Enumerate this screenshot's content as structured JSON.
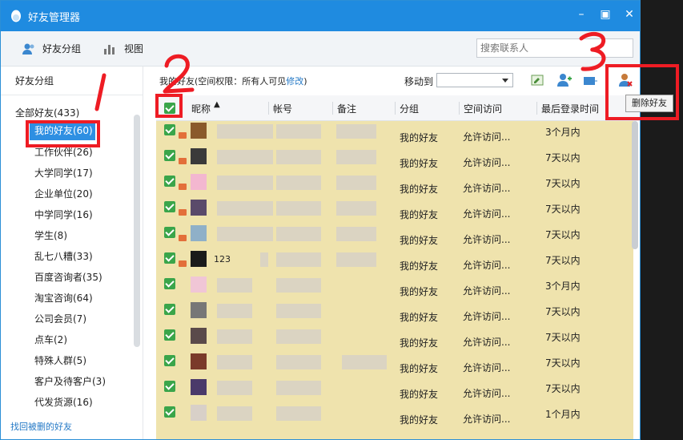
{
  "window": {
    "title": "好友管理器"
  },
  "toolbar": {
    "friend_groups": "好友分组",
    "view": "视图",
    "search_placeholder": "搜索联系人"
  },
  "sidebar": {
    "heading": "好友分组",
    "all": "全部好友(433)",
    "groups": [
      {
        "label": "我的好友(60)",
        "selected": true
      },
      {
        "label": "工作伙伴(26)"
      },
      {
        "label": "大学同学(17)"
      },
      {
        "label": "企业单位(20)"
      },
      {
        "label": "中学同学(16)"
      },
      {
        "label": "学生(8)"
      },
      {
        "label": "乱七八糟(33)"
      },
      {
        "label": "百度咨询者(35)"
      },
      {
        "label": "淘宝咨询(64)"
      },
      {
        "label": "公司会员(7)"
      },
      {
        "label": "点车(2)"
      },
      {
        "label": "特殊人群(5)"
      },
      {
        "label": "客户及待客户(3)"
      },
      {
        "label": "代发货源(16)"
      }
    ],
    "restore_link": "找回被删的好友"
  },
  "main": {
    "perm_prefix": "我的好友(空间权限：所有人可见",
    "perm_link": "修改",
    "perm_suffix": ")",
    "move_to": "移动到",
    "delete_tooltip": "删除好友",
    "columns": [
      "昵称",
      "帐号",
      "备注",
      "分组",
      "空间访问",
      "最后登录时间"
    ],
    "rows": [
      {
        "nick": "",
        "group": "我的好友",
        "space": "允许访问...",
        "last": "3个月内"
      },
      {
        "nick": "",
        "group": "我的好友",
        "space": "允许访问...",
        "last": "7天以内"
      },
      {
        "nick": "",
        "group": "我的好友",
        "space": "允许访问...",
        "last": "7天以内"
      },
      {
        "nick": "",
        "group": "我的好友",
        "space": "允许访问...",
        "last": "7天以内"
      },
      {
        "nick": "",
        "group": "我的好友",
        "space": "允许访问...",
        "last": "7天以内"
      },
      {
        "nick": "123",
        "group": "我的好友",
        "space": "允许访问...",
        "last": "7天以内"
      },
      {
        "nick": "",
        "group": "我的好友",
        "space": "允许访问...",
        "last": "3个月内"
      },
      {
        "nick": "",
        "group": "我的好友",
        "space": "允许访问...",
        "last": "7天以内"
      },
      {
        "nick": "",
        "group": "我的好友",
        "space": "允许访问...",
        "last": "7天以内"
      },
      {
        "nick": "",
        "group": "我的好友",
        "space": "允许访问...",
        "last": "7天以内"
      },
      {
        "nick": "",
        "group": "我的好友",
        "space": "允许访问...",
        "last": "7天以内"
      },
      {
        "nick": "",
        "group": "我的好友",
        "space": "允许访问...",
        "last": "1个月内"
      }
    ]
  },
  "annotations": [
    "1",
    "2",
    "3"
  ],
  "colors": {
    "accent": "#1f8be0",
    "selected": "#2e8fe2",
    "row_bg": "#efe3ad",
    "annotation": "#ee1c24"
  }
}
